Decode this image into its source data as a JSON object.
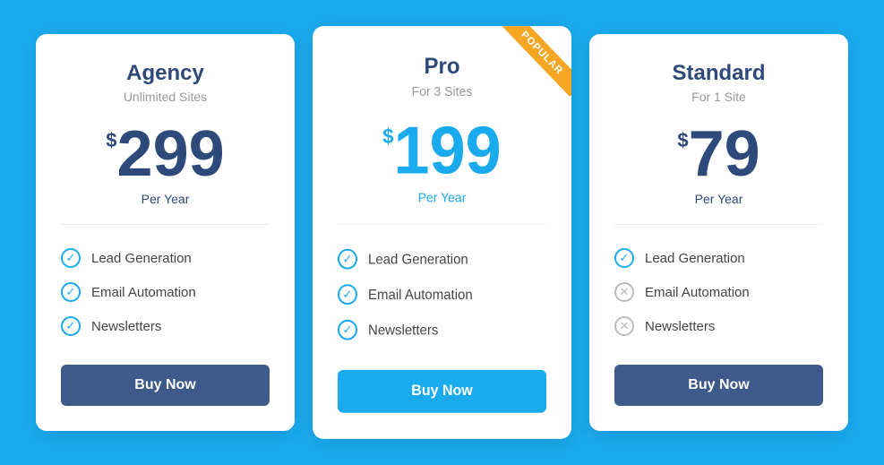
{
  "plans": [
    {
      "id": "agency",
      "name": "Agency",
      "subtitle": "Unlimited Sites",
      "price_dollar": "$",
      "price_amount": "299",
      "price_period": "Per Year",
      "featured": false,
      "ribbon": null,
      "features": [
        {
          "label": "Lead Generation",
          "included": true
        },
        {
          "label": "Email Automation",
          "included": true
        },
        {
          "label": "Newsletters",
          "included": true
        }
      ],
      "button_label": "Buy Now",
      "button_style": "dark"
    },
    {
      "id": "pro",
      "name": "Pro",
      "subtitle": "For 3 Sites",
      "price_dollar": "$",
      "price_amount": "199",
      "price_period": "Per Year",
      "featured": true,
      "ribbon": "POPULAR",
      "features": [
        {
          "label": "Lead Generation",
          "included": true
        },
        {
          "label": "Email Automation",
          "included": true
        },
        {
          "label": "Newsletters",
          "included": true
        }
      ],
      "button_label": "Buy Now",
      "button_style": "blue"
    },
    {
      "id": "standard",
      "name": "Standard",
      "subtitle": "For 1 Site",
      "price_dollar": "$",
      "price_amount": "79",
      "price_period": "Per Year",
      "featured": false,
      "ribbon": null,
      "features": [
        {
          "label": "Lead Generation",
          "included": true
        },
        {
          "label": "Email Automation",
          "included": false
        },
        {
          "label": "Newsletters",
          "included": false
        }
      ],
      "button_label": "Buy Now",
      "button_style": "dark"
    }
  ]
}
